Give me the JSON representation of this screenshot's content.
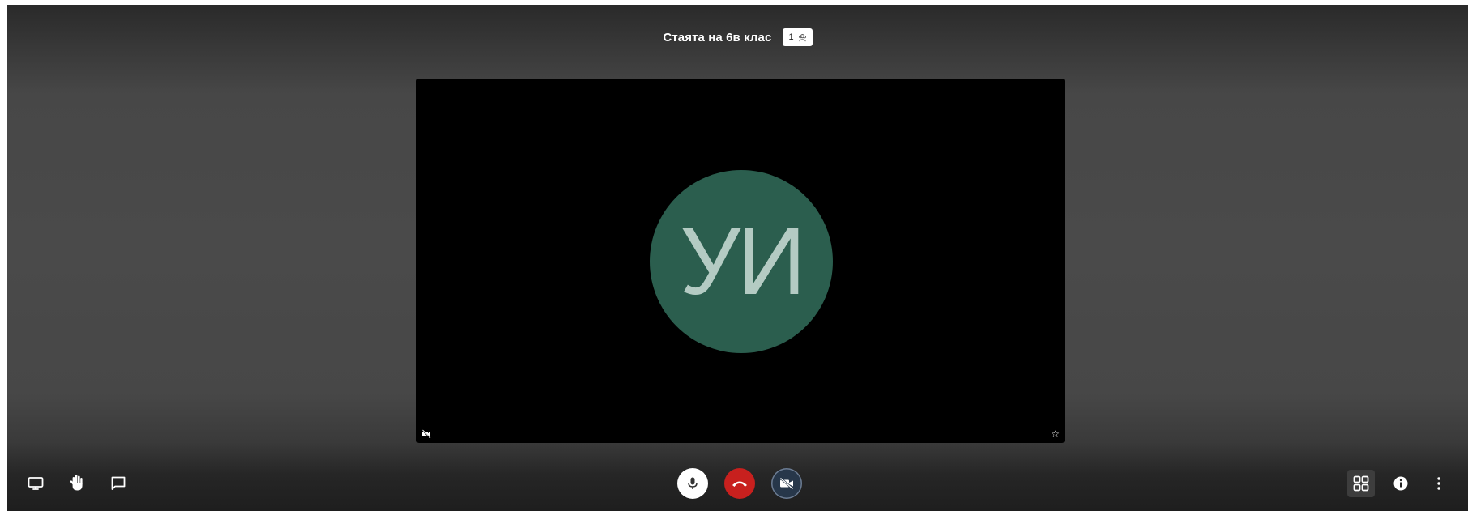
{
  "header": {
    "meeting_title": "Стаята на 6в клас",
    "participant_count": "1"
  },
  "video_tile": {
    "avatar_initials": "УИ",
    "avatar_color": "#2b5e4e",
    "icons": [
      "camera-off-icon",
      "star-icon"
    ]
  },
  "toolbar": {
    "left": [
      "screen-share-icon",
      "raise-hand-icon",
      "chat-icon"
    ],
    "center": [
      "microphone-icon",
      "hangup-icon",
      "camera-off-icon"
    ],
    "right": [
      "tile-view-icon",
      "info-icon",
      "more-options-icon"
    ]
  },
  "colors": {
    "hangup": "#c8201e",
    "camera_button": "#27374a",
    "background": "#474747"
  }
}
